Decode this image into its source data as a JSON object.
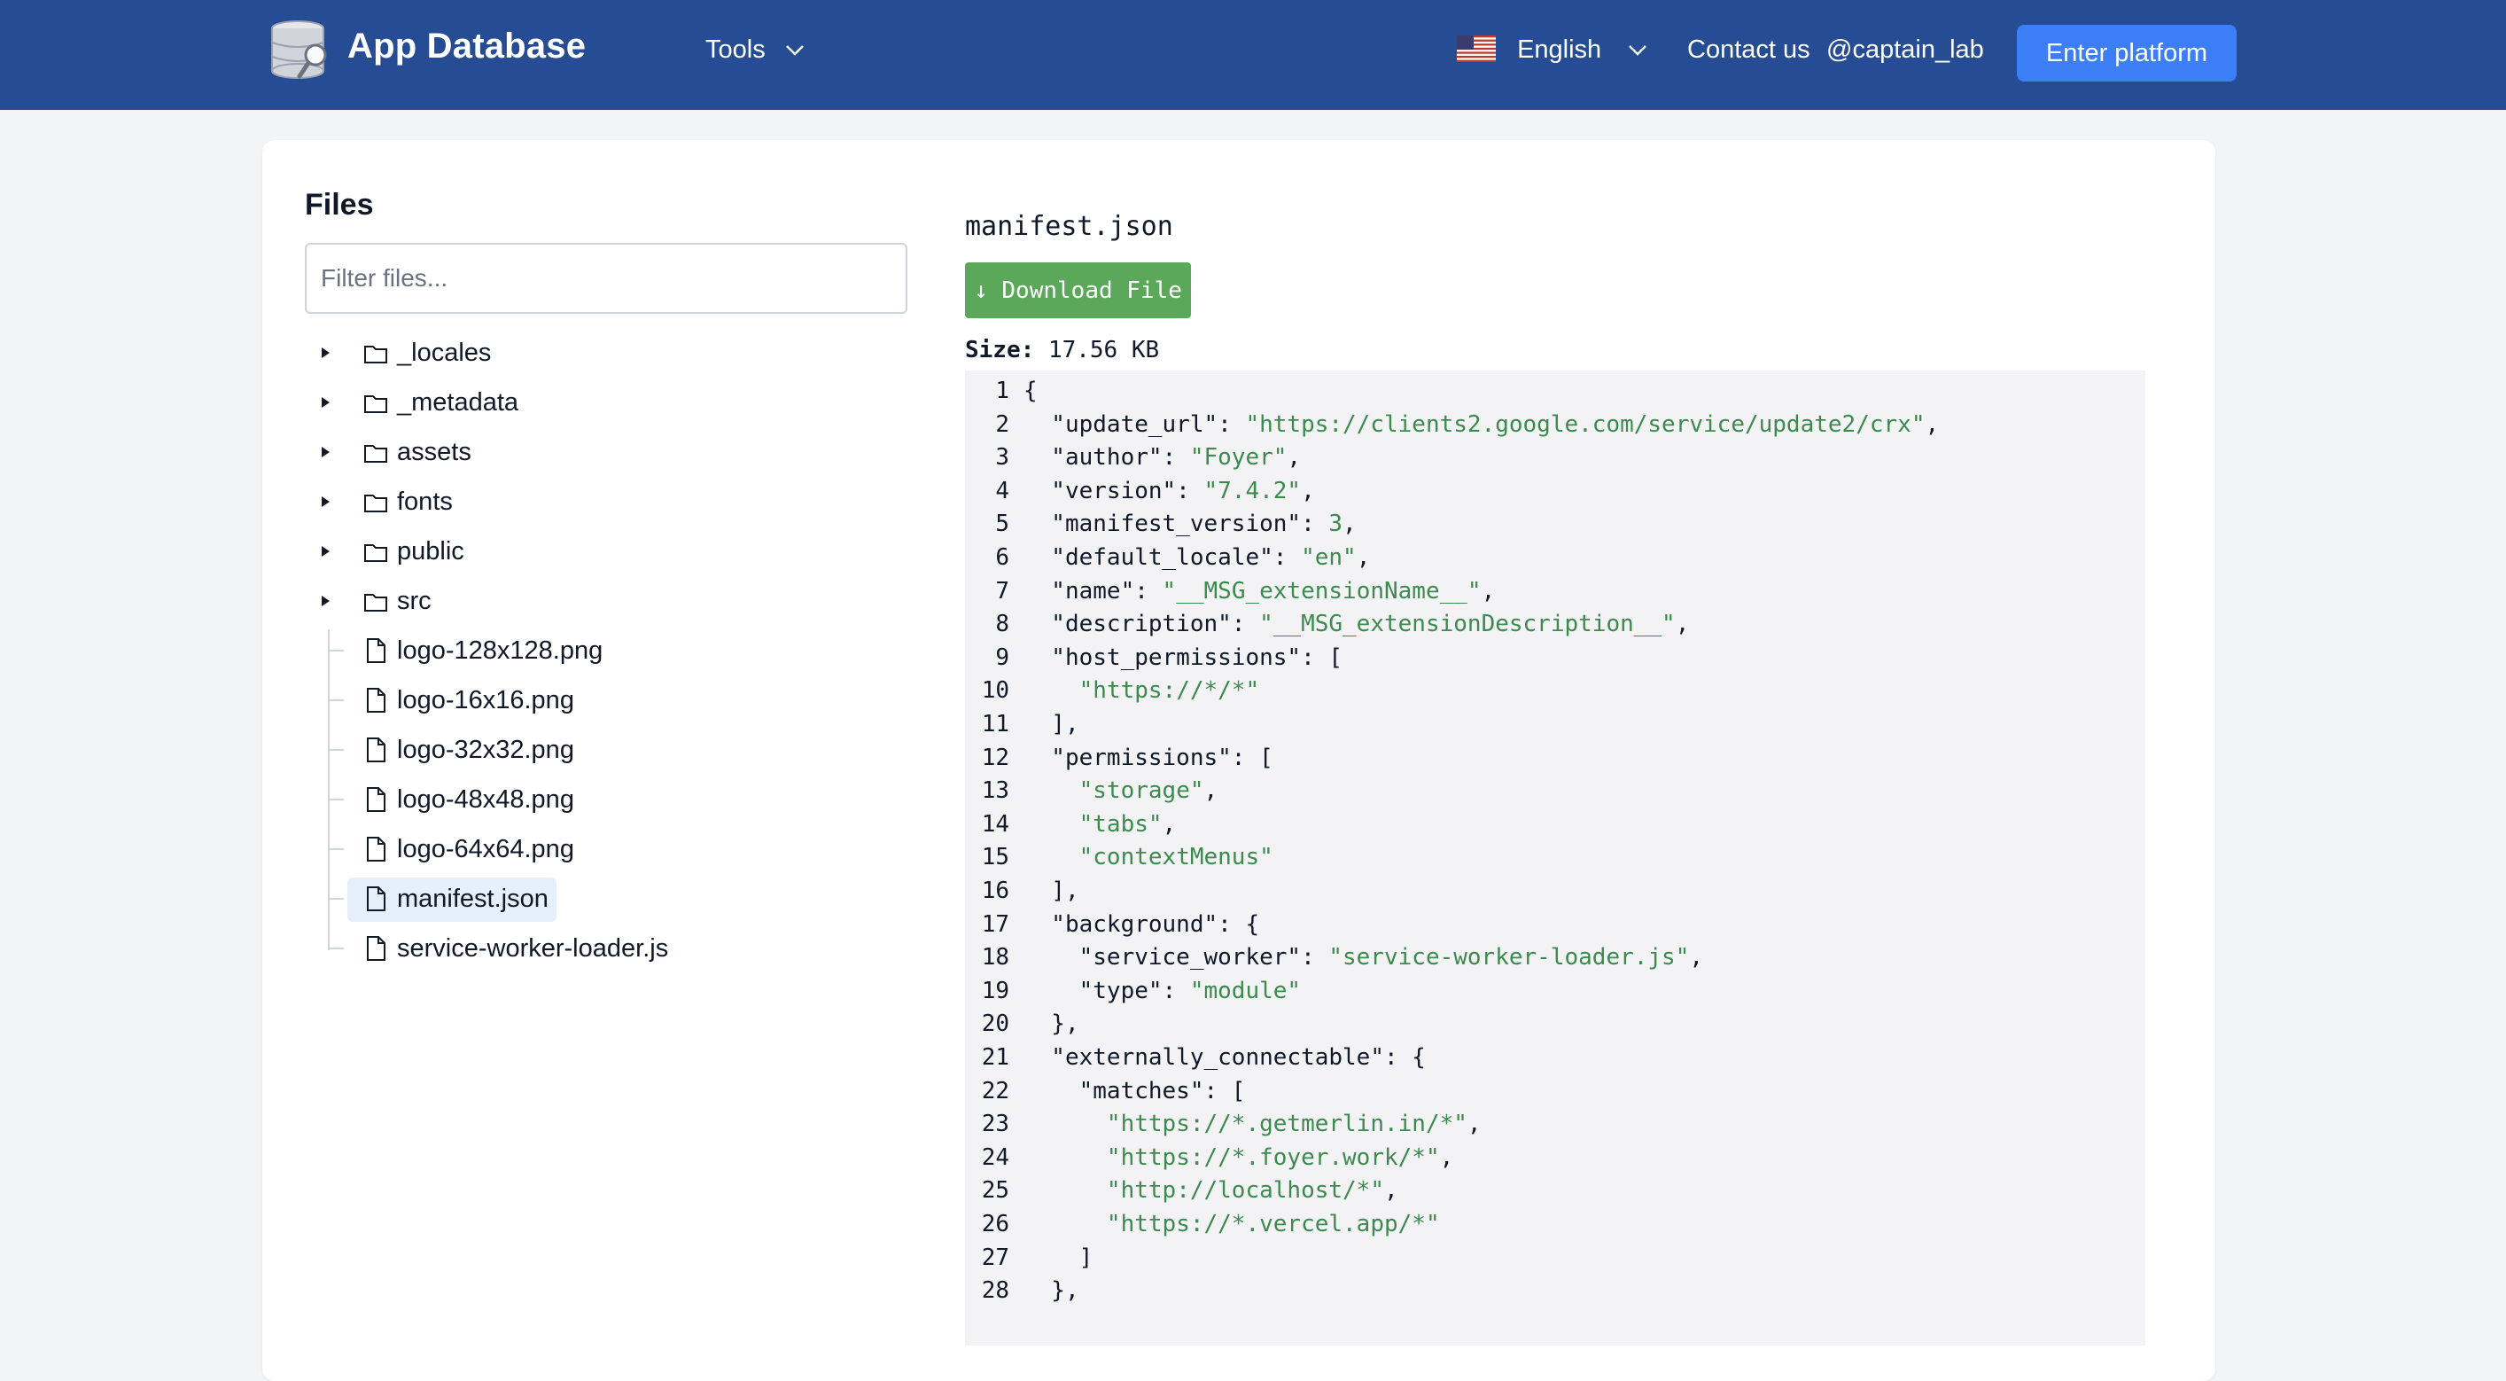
{
  "header": {
    "brand": "App Database",
    "tools_label": "Tools",
    "language_label": "English",
    "contact_label": "Contact us",
    "handle": "@captain_lab",
    "enter_button": "Enter platform",
    "colors": {
      "bar": "#264c94",
      "button": "#3b7ef6"
    }
  },
  "sidebar": {
    "title": "Files",
    "filter_placeholder": "Filter files...",
    "folders": [
      "_locales",
      "_metadata",
      "assets",
      "fonts",
      "public",
      "src"
    ],
    "files": [
      "logo-128x128.png",
      "logo-16x16.png",
      "logo-32x32.png",
      "logo-48x48.png",
      "logo-64x64.png",
      "manifest.json",
      "service-worker-loader.js"
    ],
    "selected": "manifest.json"
  },
  "viewer": {
    "filename": "manifest.json",
    "download_label": "↓ Download File",
    "size_label": "Size:",
    "size_value": "17.56 KB",
    "lines": [
      [
        "{"
      ],
      [
        "  \"update_url\": ",
        "\"https://clients2.google.com/service/update2/crx\"",
        ","
      ],
      [
        "  \"author\": ",
        "\"Foyer\"",
        ","
      ],
      [
        "  \"version\": ",
        "\"7.4.2\"",
        ","
      ],
      [
        "  \"manifest_version\": ",
        "3",
        ","
      ],
      [
        "  \"default_locale\": ",
        "\"en\"",
        ","
      ],
      [
        "  \"name\": ",
        "\"__MSG_extensionName__\"",
        ","
      ],
      [
        "  \"description\": ",
        "\"__MSG_extensionDescription__\"",
        ","
      ],
      [
        "  \"host_permissions\": ["
      ],
      [
        "    ",
        "\"https://*/*\""
      ],
      [
        "  ],"
      ],
      [
        "  \"permissions\": ["
      ],
      [
        "    ",
        "\"storage\"",
        ","
      ],
      [
        "    ",
        "\"tabs\"",
        ","
      ],
      [
        "    ",
        "\"contextMenus\""
      ],
      [
        "  ],"
      ],
      [
        "  \"background\": {"
      ],
      [
        "    \"service_worker\": ",
        "\"service-worker-loader.js\"",
        ","
      ],
      [
        "    \"type\": ",
        "\"module\""
      ],
      [
        "  },"
      ],
      [
        "  \"externally_connectable\": {"
      ],
      [
        "    \"matches\": ["
      ],
      [
        "      ",
        "\"https://*.getmerlin.in/*\"",
        ","
      ],
      [
        "      ",
        "\"https://*.foyer.work/*\"",
        ","
      ],
      [
        "      ",
        "\"http://localhost/*\"",
        ","
      ],
      [
        "      ",
        "\"https://*.vercel.app/*\""
      ],
      [
        "    ]"
      ],
      [
        "  },"
      ]
    ]
  }
}
